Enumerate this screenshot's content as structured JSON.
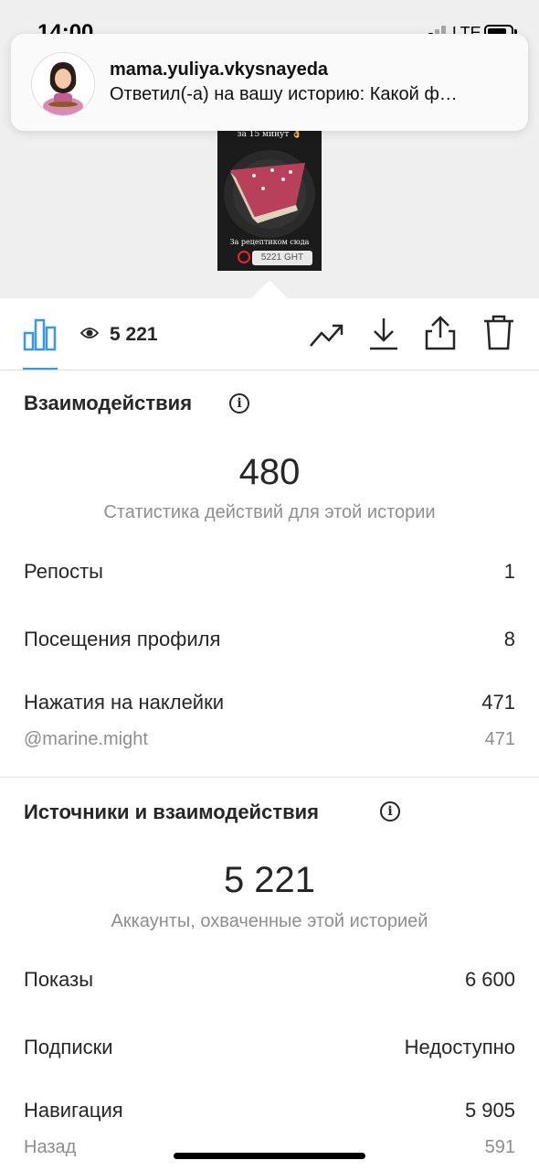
{
  "status_bar": {
    "time": "14:00",
    "network": "LTE",
    "icons": [
      "signal-icon",
      "battery-icon"
    ]
  },
  "notification": {
    "username": "mama.yuliya.vkysnayeda",
    "text": "Ответил(-а) на вашу историю: Какой ф…"
  },
  "story_preview": {
    "caption_top": "за 15 минут 👌",
    "caption_bottom": "За рецептиком сюда",
    "sticker_text": "5221 GHT"
  },
  "toolbar": {
    "views": "5 221",
    "icons": [
      "bar-chart-icon",
      "eye-icon",
      "trend-icon",
      "download-icon",
      "share-icon",
      "trash-icon"
    ],
    "accent_color": "#3897f0"
  },
  "interactions": {
    "title": "Взаимодействия",
    "total": "480",
    "caption": "Статистика действий для этой истории",
    "rows": [
      {
        "label": "Репосты",
        "value": "1"
      },
      {
        "label": "Посещения профиля",
        "value": "8"
      },
      {
        "label": "Нажатия на наклейки",
        "value": "471"
      }
    ],
    "sticker_sub": {
      "label": "@marine.might",
      "value": "471"
    }
  },
  "discovery": {
    "title": "Источники и взаимодействия",
    "total": "5 221",
    "caption": "Аккаунты, охваченные этой историей",
    "rows": [
      {
        "label": "Показы",
        "value": "6 600"
      },
      {
        "label": "Подписки",
        "value": "Недоступно"
      },
      {
        "label": "Навигация",
        "value": "5 905"
      }
    ],
    "nav_sub": {
      "label": "Назад",
      "value": "591"
    }
  }
}
